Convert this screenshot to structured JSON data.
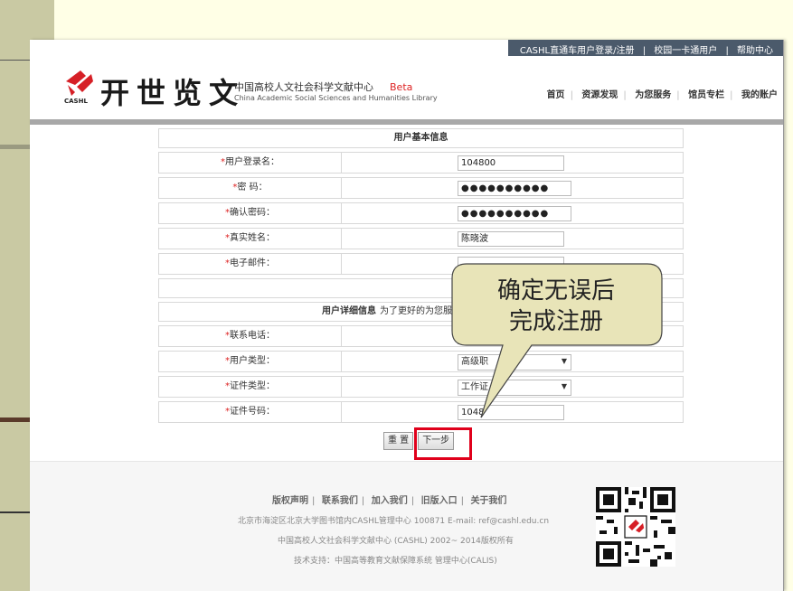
{
  "toplinks": {
    "login": "CASHL直通车用户登录/注册",
    "campus": "校园一卡通用户",
    "help": "帮助中心",
    "sep": "|"
  },
  "logo": {
    "title": "开世览文",
    "brand": "CASHL"
  },
  "org": {
    "cn": "中国高校人文社会科学文献中心",
    "beta": "Beta",
    "en": "China Academic Social Sciences and Humanities Library"
  },
  "mainnav": [
    "首页",
    "资源发现",
    "为您服务",
    "馆员专栏",
    "我的账户"
  ],
  "form": {
    "basic_header": "用户基本信息",
    "required_mark": "*",
    "fields": [
      {
        "label": "用户登录名：",
        "value": "104800",
        "type": "text"
      },
      {
        "label": "密 码：",
        "value": "●●●●●●●●●●",
        "type": "password"
      },
      {
        "label": "确认密码：",
        "value": "●●●●●●●●●●",
        "type": "password"
      },
      {
        "label": "真实姓名：",
        "value": "陈晓波",
        "type": "text"
      },
      {
        "label": "电子邮件：",
        "value": "",
        "type": "text"
      }
    ],
    "detail_header": "用户详细信息",
    "detail_hint": "为了更好的为您服",
    "detail_fields": [
      {
        "label": "联系电话：",
        "value": "",
        "type": "text"
      },
      {
        "label": "用户类型：",
        "value": "高级职",
        "type": "select"
      },
      {
        "label": "证件类型：",
        "value": "工作证",
        "type": "select"
      },
      {
        "label": "证件号码：",
        "value": "1048",
        "type": "text"
      }
    ],
    "reset_label": "重 置",
    "next_label": "下一步"
  },
  "footer": {
    "links": [
      "版权声明",
      "联系我们",
      "加入我们",
      "旧版入口",
      "关于我们"
    ],
    "sep": "|",
    "address": "北京市海淀区北京大学图书馆内CASHL管理中心 100871 E-mail: ref@cashl.edu.cn",
    "copyright": "中国高校人文社会科学文献中心 (CASHL) 2002~ 2014版权所有",
    "support": "技术支持：中国高等教育文献保障系统 管理中心(CALIS)"
  },
  "callout": {
    "line1": "确定无误后",
    "line2": "完成注册"
  },
  "colors": {
    "accent_red": "#e0001b",
    "callout_fill": "#e8e4b8",
    "topbar": "#4b5a6b"
  }
}
